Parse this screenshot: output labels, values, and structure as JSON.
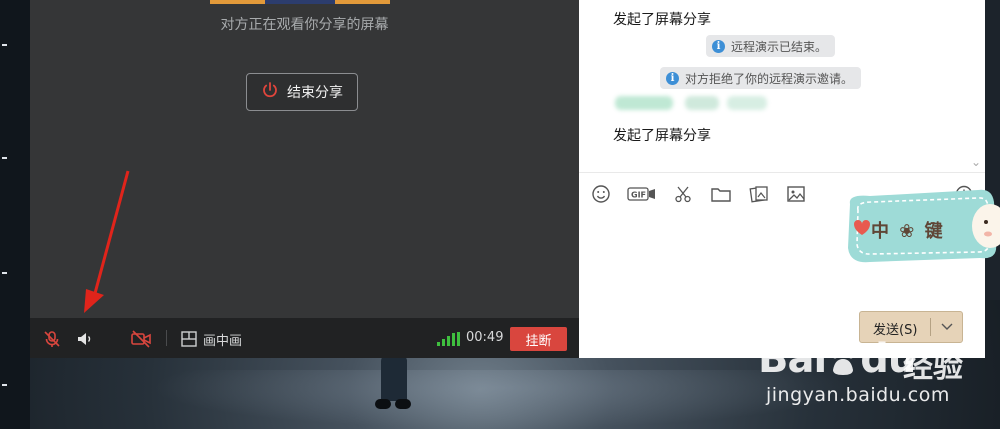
{
  "call": {
    "status_text": "对方正在观看你分享的屏幕",
    "end_share_label": "结束分享",
    "toolbar": {
      "pip_label": "画中画",
      "timer": "00:49",
      "hangup_label": "挂断",
      "mic_icon": "mic-muted-icon",
      "speaker_icon": "speaker-icon",
      "camera_icon": "camera-off-icon",
      "pip_icon": "picture-in-picture-icon"
    }
  },
  "chat": {
    "messages": [
      {
        "type": "text",
        "text": "发起了屏幕分享"
      },
      {
        "type": "system",
        "text": "远程演示已结束。"
      },
      {
        "type": "system",
        "text": "对方拒绝了你的远程演示邀请。"
      },
      {
        "type": "text",
        "text": "发起了屏幕分享"
      }
    ],
    "toolbar_icons": [
      "emoji-icon",
      "gif-icon",
      "scissors-icon",
      "folder-icon",
      "image-gallery-icon",
      "image-icon",
      "history-clock-icon"
    ],
    "send_label": "发送(S)"
  },
  "sticker": {
    "text": "中 ❀ 键"
  },
  "watermark": {
    "brand": "Bai",
    "brand2": "du",
    "cn": "经验",
    "url": "jingyan.baidu.com"
  },
  "colors": {
    "hangup": "#d9463e",
    "send_button": "#e6d3b8",
    "signal": "#3fbf3f",
    "info": "#3d8fd6",
    "annotation_arrow": "#e0241b"
  }
}
